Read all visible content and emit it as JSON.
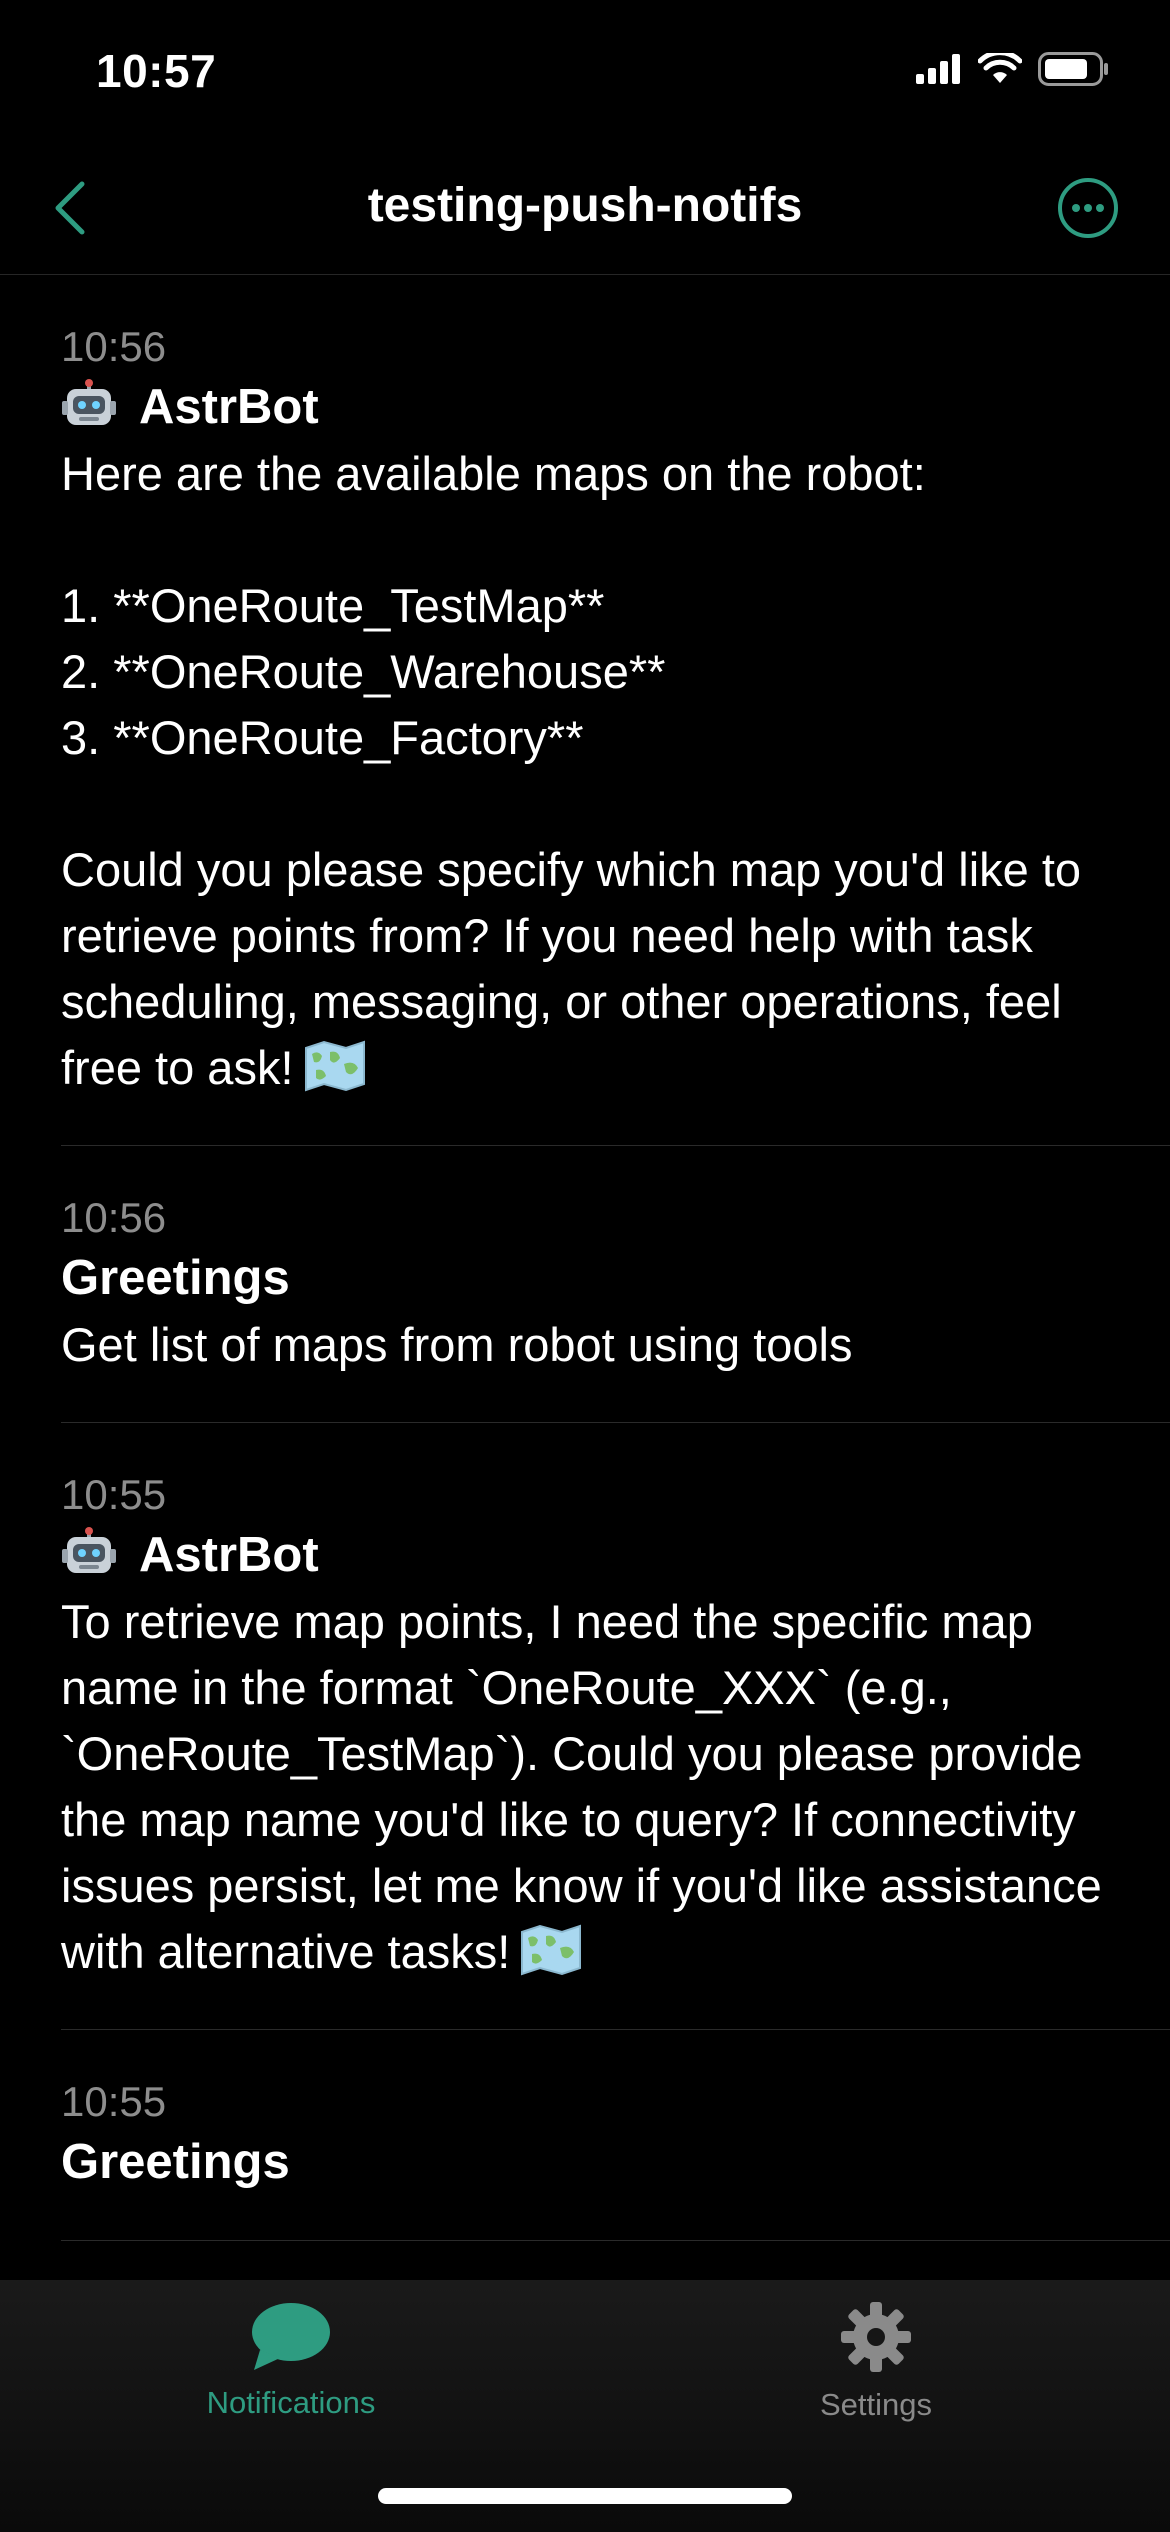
{
  "status_bar": {
    "time": "10:57",
    "icons": [
      "cellular-signal-icon",
      "wifi-icon",
      "battery-icon"
    ]
  },
  "nav": {
    "title": "testing-push-notifs",
    "back_icon": "chevron-left-icon",
    "more_icon": "ellipsis-circle-icon",
    "accent_color": "#2e9c81"
  },
  "messages": [
    {
      "time": "10:56",
      "sender": "AstrBot",
      "sender_icon": "robot-emoji",
      "body": "Here are the available maps on the robot:\n\n1. **OneRoute_TestMap**\n2. **OneRoute_Warehouse**\n3. **OneRoute_Factory**\n\nCould you please specify which map you'd like to retrieve points from? If you need help with task scheduling, messaging, or other operations, feel free to ask!",
      "trailing_icon": "world-map-emoji"
    },
    {
      "time": "10:56",
      "sender": "Greetings",
      "body": "Get list of maps from robot using tools"
    },
    {
      "time": "10:55",
      "sender": "AstrBot",
      "sender_icon": "robot-emoji",
      "body": "To retrieve map points, I need the specific map name in the format `OneRoute_XXX` (e.g., `OneRoute_TestMap`). Could you please provide the map name you'd like to query? If connectivity issues persist, let me know if you'd like assistance with alternative tasks!",
      "trailing_icon": "world-map-emoji"
    },
    {
      "time": "10:55",
      "sender": "Greetings",
      "body": ""
    }
  ],
  "tab_bar": {
    "tabs": [
      {
        "label": "Notifications",
        "icon": "chat-bubble-icon",
        "active": true,
        "color": "#2e9c81"
      },
      {
        "label": "Settings",
        "icon": "gear-icon",
        "active": false,
        "color": "#8a8a8a"
      }
    ]
  }
}
